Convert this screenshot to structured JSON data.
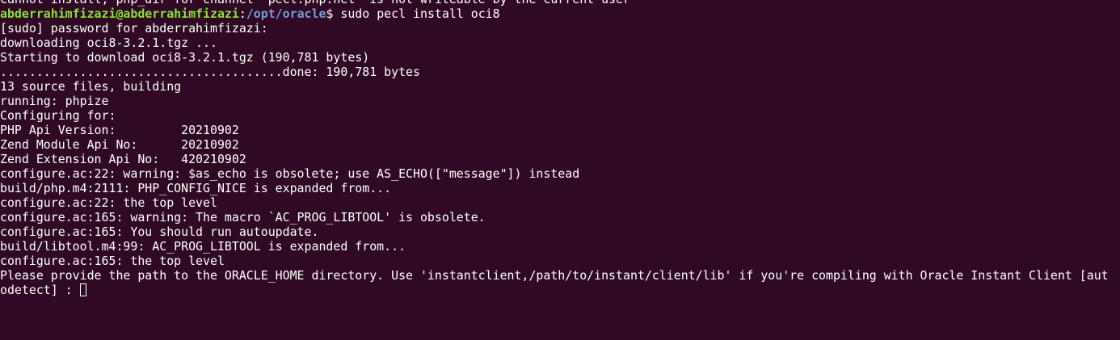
{
  "terminal": {
    "lines": [
      "Cannot install, php_dir for channel \"pecl.php.net\" is not writeable by the current user",
      "",
      "[sudo] password for abderrahimfizazi:",
      "downloading oci8-3.2.1.tgz ...",
      "Starting to download oci8-3.2.1.tgz (190,781 bytes)",
      ".......................................done: 190,781 bytes",
      "13 source files, building",
      "running: phpize",
      "Configuring for:",
      "PHP Api Version:         20210902",
      "Zend Module Api No:      20210902",
      "Zend Extension Api No:   420210902",
      "configure.ac:22: warning: $as_echo is obsolete; use AS_ECHO([\"message\"]) instead",
      "build/php.m4:2111: PHP_CONFIG_NICE is expanded from...",
      "configure.ac:22: the top level",
      "configure.ac:165: warning: The macro `AC_PROG_LIBTOOL' is obsolete.",
      "configure.ac:165: You should run autoupdate.",
      "build/libtool.m4:99: AC_PROG_LIBTOOL is expanded from...",
      "configure.ac:165: the top level",
      "Please provide the path to the ORACLE_HOME directory. Use 'instantclient,/path/to/instant/client/lib' if you're compiling with Oracle Instant Client [aut",
      "odetect] : "
    ],
    "prompt": {
      "user_host": "abderrahimfizazi@abderrahimfizazi",
      "colon": ":",
      "path": "/opt/oracle",
      "symbol": "$",
      "command": " sudo pecl install oci8"
    }
  },
  "colors": {
    "background": "#300a24",
    "text": "#ffffff",
    "user_host": "#8ae234",
    "path": "#729fcf"
  }
}
